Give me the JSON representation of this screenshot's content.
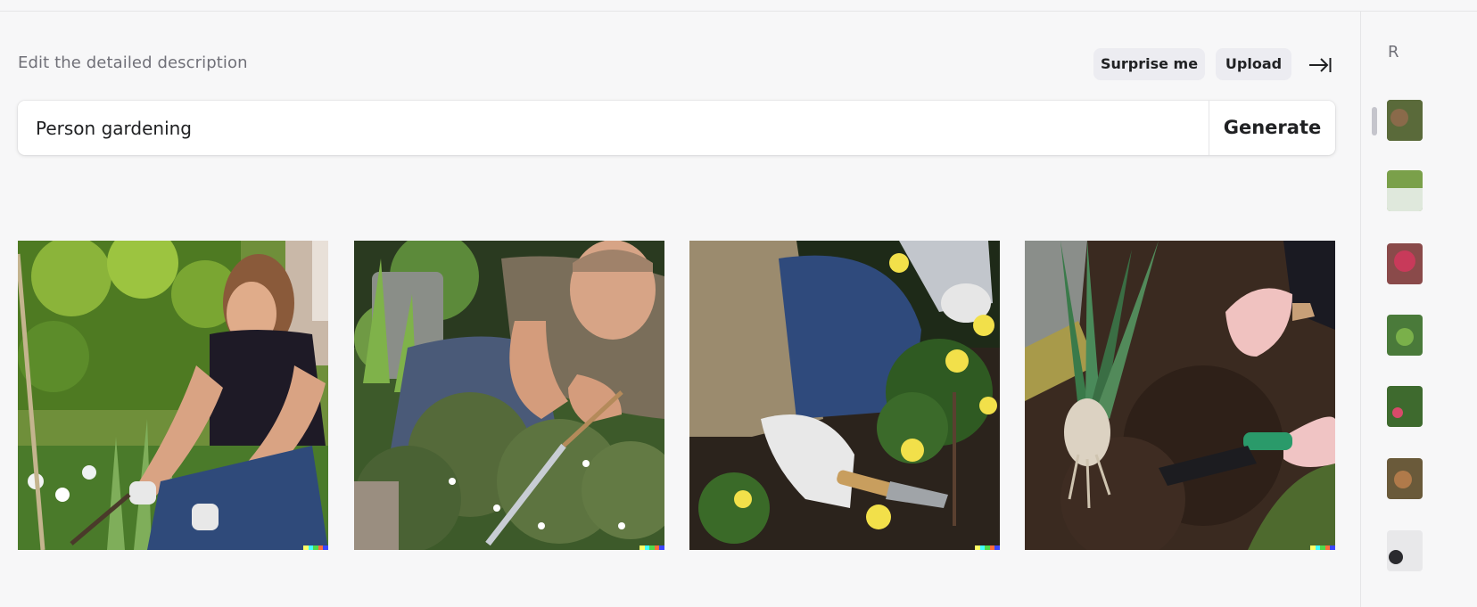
{
  "editor": {
    "hint": "Edit the detailed description",
    "surprise_label": "Surprise me",
    "upload_label": "Upload",
    "collapse_icon": "collapse-right-icon"
  },
  "prompt": {
    "value": "Person gardening",
    "generate_label": "Generate"
  },
  "results": [
    {
      "subject": "woman-gardening"
    },
    {
      "subject": "man-pruning-bush"
    },
    {
      "subject": "gloved-hands-planting-flowers"
    },
    {
      "subject": "hands-planting-bulb"
    }
  ],
  "signature_colors": [
    "#ffff66",
    "#42ffff",
    "#51da4c",
    "#ff6e3c",
    "#3c46ff"
  ],
  "sidebar": {
    "title_fragment": "R",
    "thumb_count": 7
  }
}
